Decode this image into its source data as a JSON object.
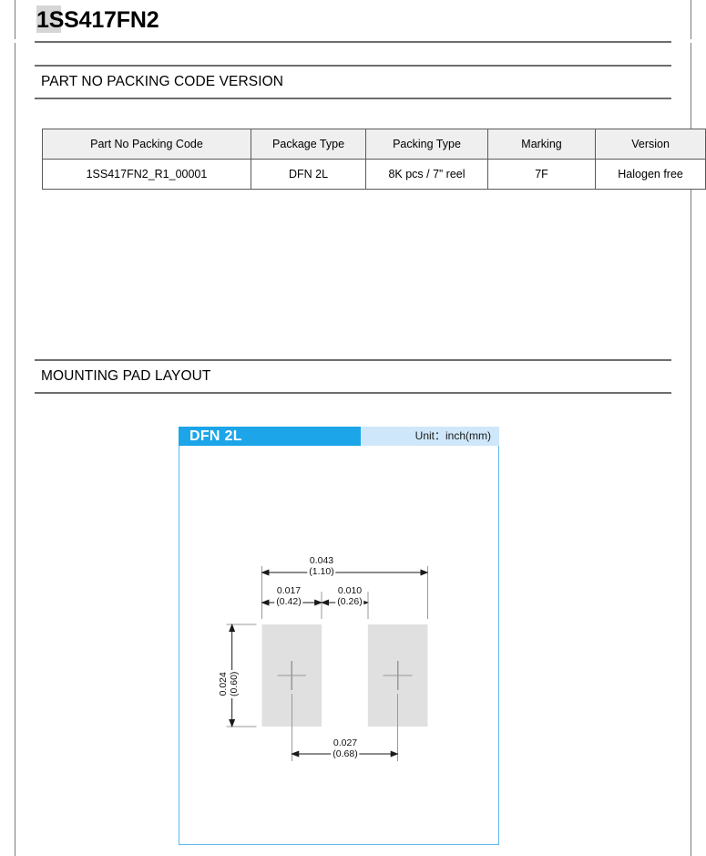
{
  "page": {
    "part_title": "1SS417FN2"
  },
  "sections": {
    "part_no": {
      "title": "PART NO PACKING CODE VERSION"
    },
    "mounting": {
      "title": "MOUNTING PAD LAYOUT"
    }
  },
  "spec_table": {
    "headers": [
      "Part No Packing Code",
      "Package Type",
      "Packing Type",
      "Marking",
      "Version"
    ],
    "rows": [
      [
        "1SS417FN2_R1_00001",
        "DFN 2L",
        "8K pcs / 7” reel",
        "7F",
        "Halogen free"
      ]
    ]
  },
  "diagram": {
    "package_name": "DFN 2L",
    "unit_label": "Unit：inch(mm)",
    "accent_color": "#1ca5e8",
    "accent_light_color": "#cfe7fa",
    "border_color": "#5bb9ef",
    "pad_fill_color": "#e0e0e0",
    "dimensions": {
      "overall_width": {
        "inch": "0.043",
        "mm": "(1.10)"
      },
      "pad_width": {
        "inch": "0.017",
        "mm": "(0.42)"
      },
      "pad_gap": {
        "inch": "0.010",
        "mm": "(0.26)"
      },
      "pad_height": {
        "inch": "0.024",
        "mm": "(0.60)"
      },
      "pad_pitch": {
        "inch": "0.027",
        "mm": "(0.68)"
      }
    }
  }
}
